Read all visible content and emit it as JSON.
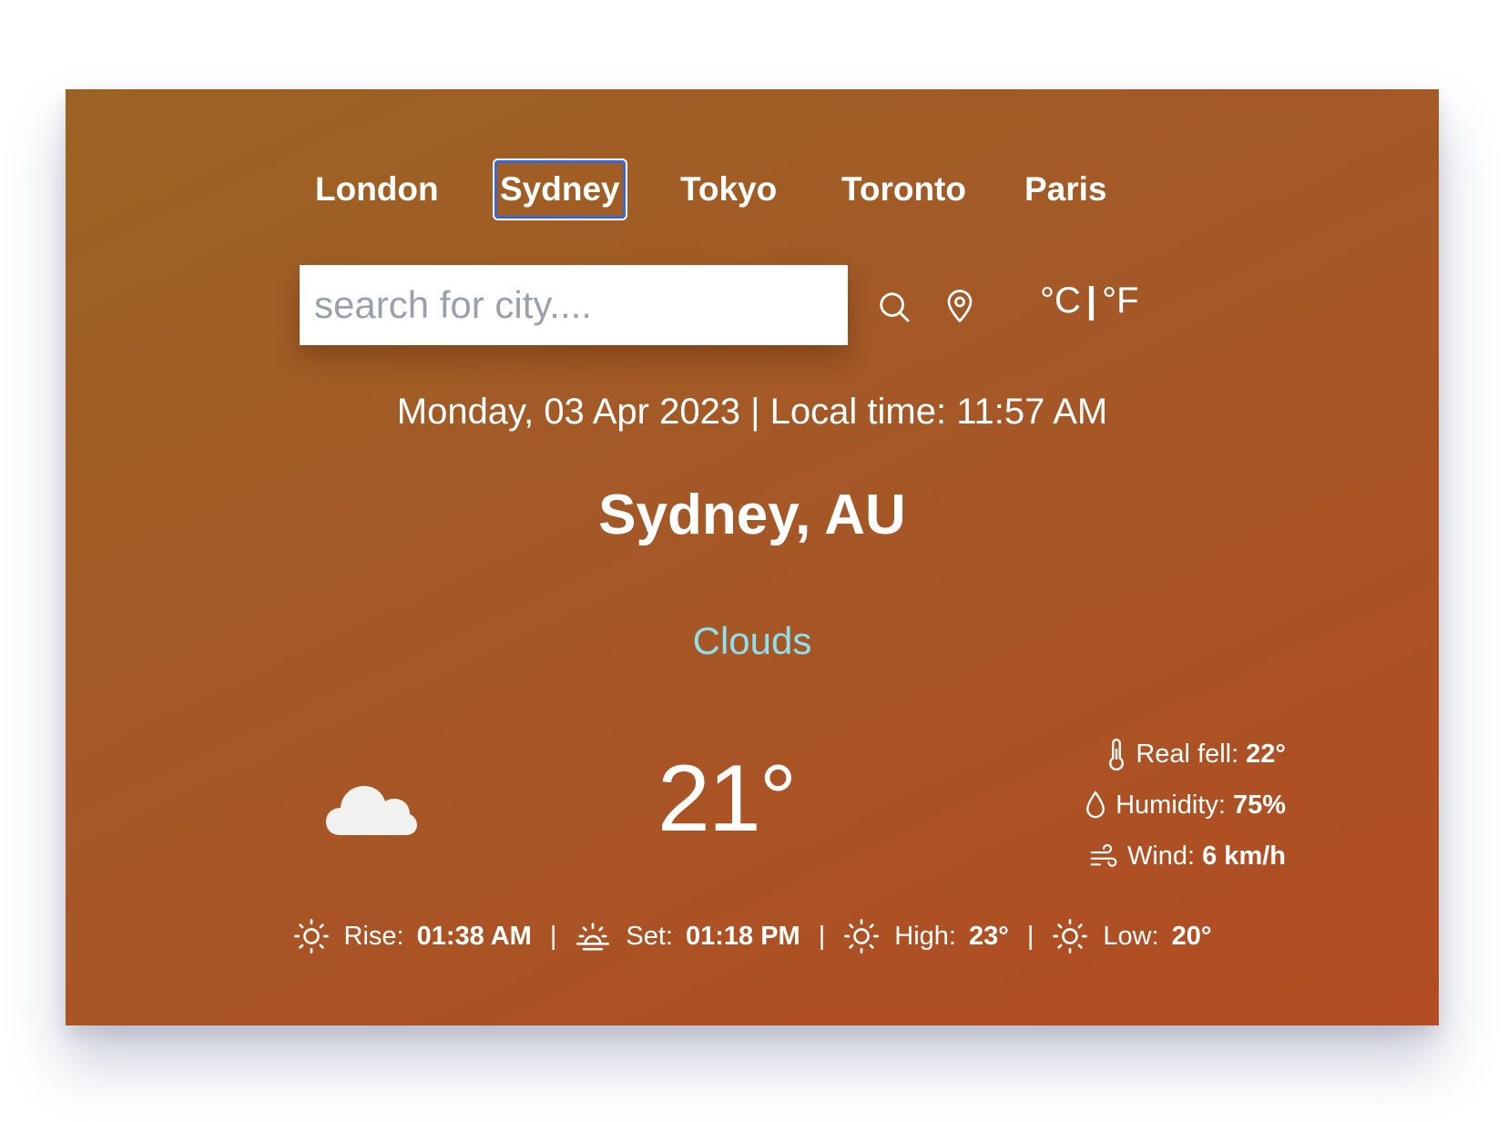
{
  "nav": {
    "cities": [
      "London",
      "Sydney",
      "Tokyo",
      "Toronto",
      "Paris"
    ],
    "active": "Sydney"
  },
  "search": {
    "placeholder": "search for city....",
    "value": ""
  },
  "icons": {
    "search": "search-icon",
    "location": "location-pin-icon",
    "weather": "cloud-icon",
    "real_feel": "thermometer-icon",
    "humidity": "droplet-icon",
    "wind": "wind-icon",
    "rise": "sun-icon",
    "set": "sunset-icon",
    "high": "sun-icon",
    "low": "sun-icon"
  },
  "units": {
    "celsius": "°C",
    "separator": "|",
    "fahrenheit": "°F"
  },
  "datetime": "Monday, 03 Apr 2023 | Local time: 11:57 AM",
  "location": "Sydney, AU",
  "condition": "Clouds",
  "temperature": "21°",
  "details": {
    "real_feel_label": "Real fell:",
    "real_feel_value": "22°",
    "humidity_label": "Humidity:",
    "humidity_value": "75%",
    "wind_label": "Wind:",
    "wind_value": "6 km/h"
  },
  "footer": {
    "rise_label": "Rise:",
    "rise_value": "01:38 AM",
    "set_label": "Set:",
    "set_value": "01:18 PM",
    "high_label": "High:",
    "high_value": "23°",
    "low_label": "Low:",
    "low_value": "20°",
    "separator": "|"
  },
  "colors": {
    "gradient_start": "#9b6323",
    "gradient_end": "#b24c22",
    "condition_text": "#8ee0ec",
    "active_outline": "#3b66d6"
  }
}
